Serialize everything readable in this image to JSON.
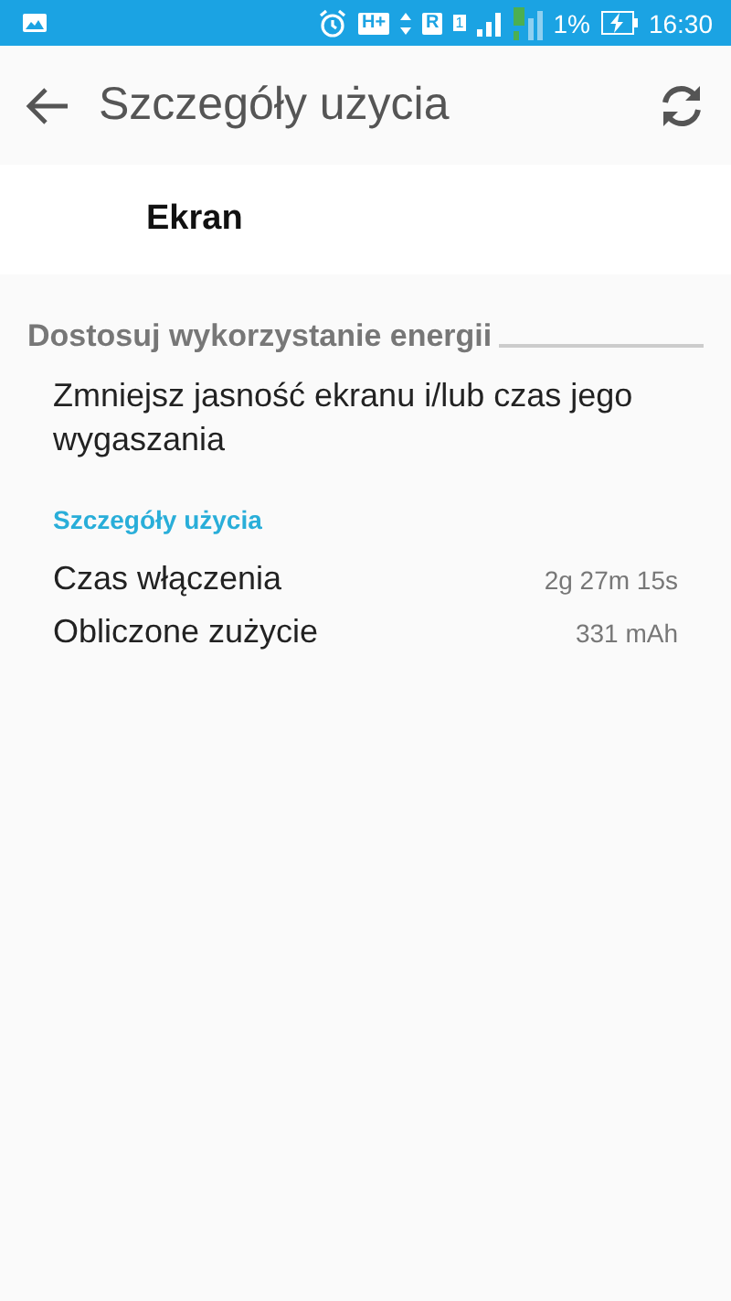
{
  "status_bar": {
    "network": "H+",
    "roaming": "R",
    "sim": "1",
    "battery": "1%",
    "time": "16:30"
  },
  "app_bar": {
    "title": "Szczegóły użycia"
  },
  "app_name": "Ekran",
  "sections": [
    {
      "kind": "header",
      "title": "Dostosuj wykorzystanie energii"
    },
    {
      "kind": "action",
      "text": "Zmniejsz jasność ekranu i/lub czas jego wygaszania"
    },
    {
      "kind": "subheader",
      "title": "Szczegóły użycia"
    },
    {
      "kind": "detail",
      "label": "Czas włączenia",
      "value": "2g 27m 15s"
    },
    {
      "kind": "detail",
      "label": "Obliczone zużycie",
      "value": "331 mAh"
    }
  ]
}
